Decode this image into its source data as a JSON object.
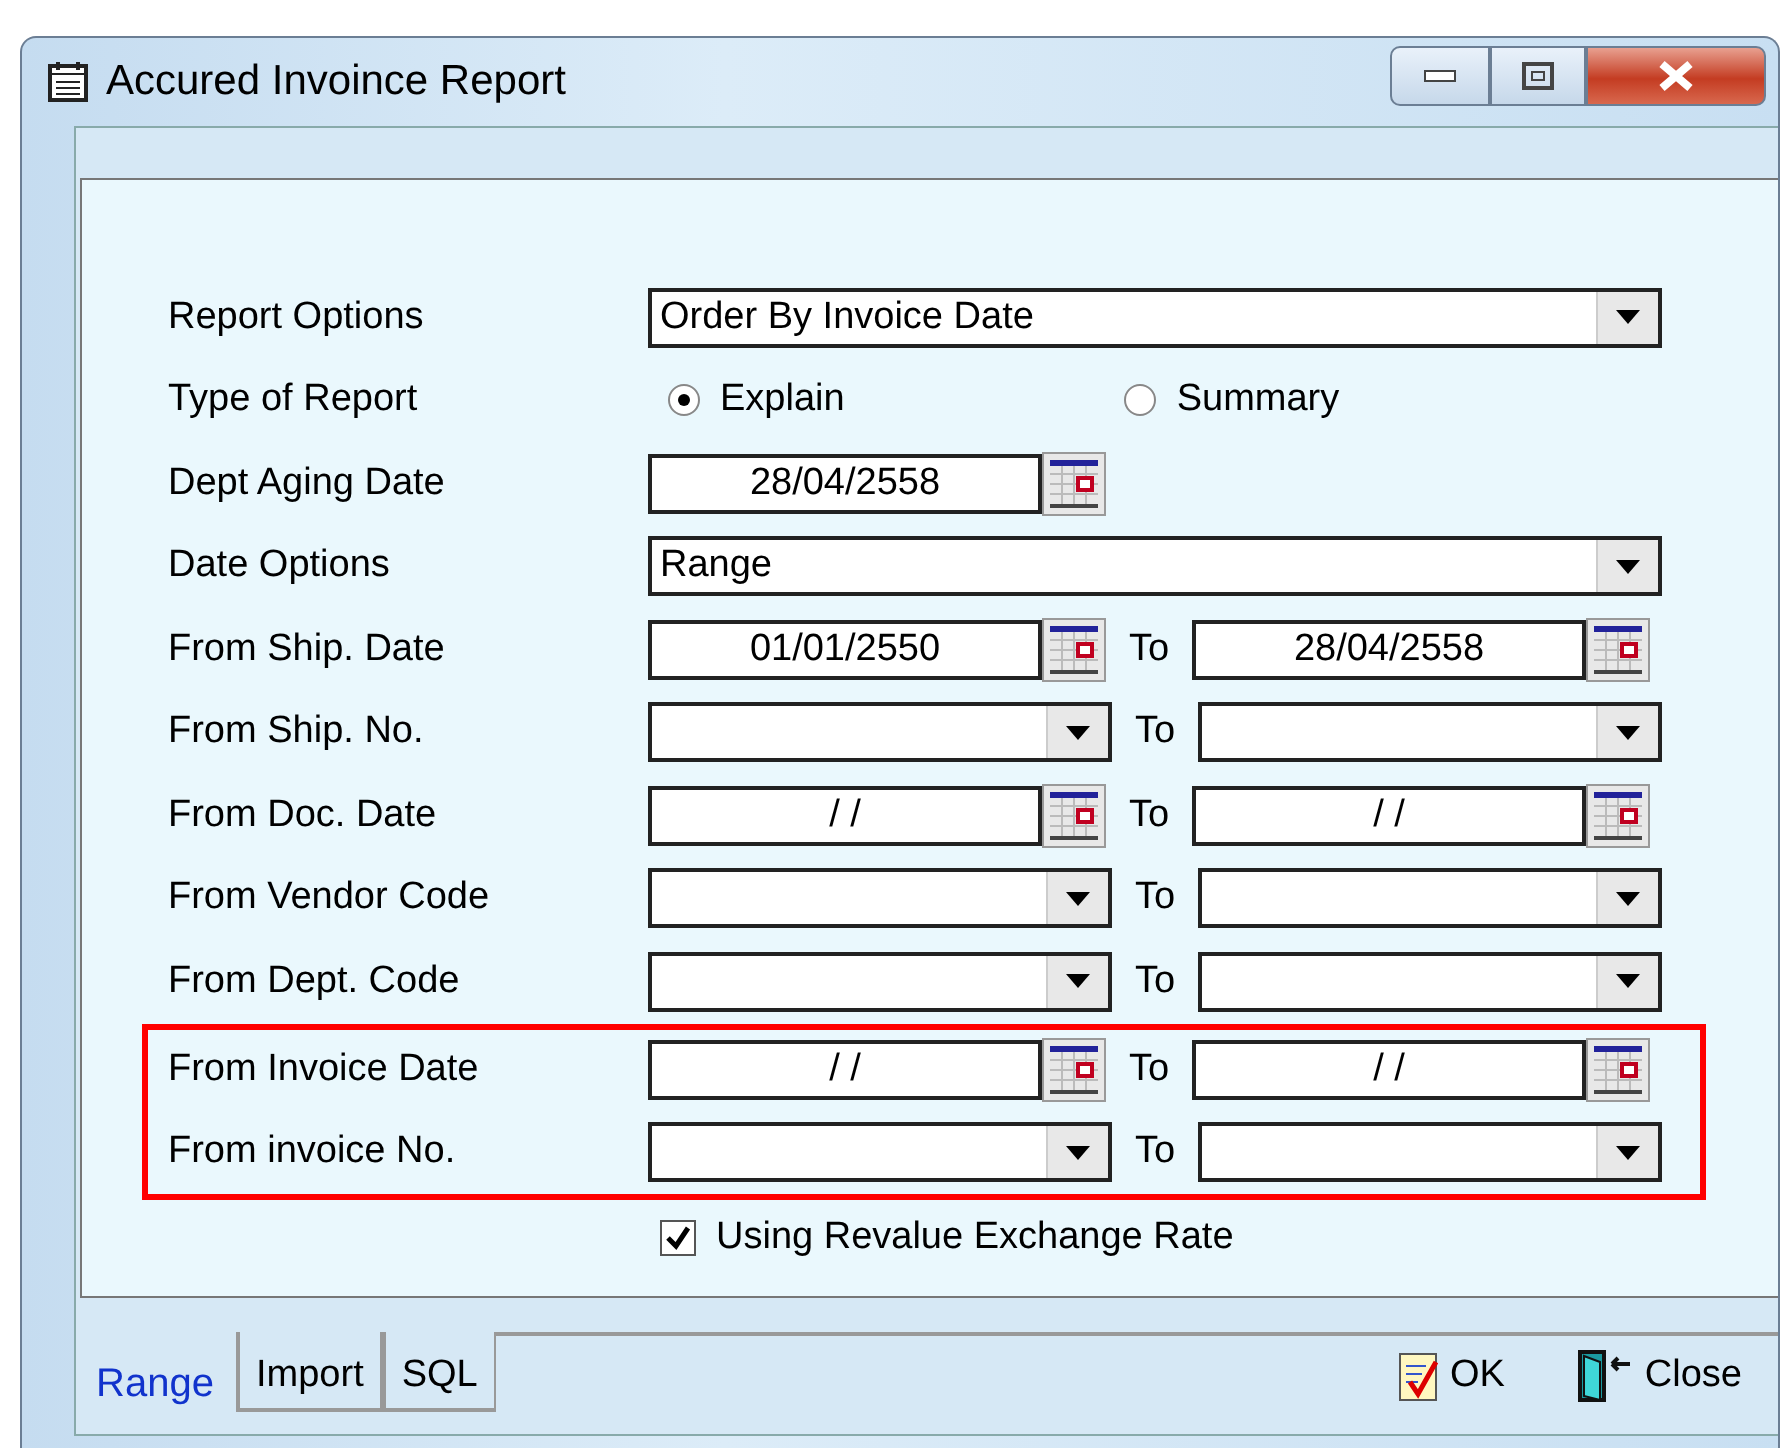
{
  "window": {
    "title": "Accured Invoince Report"
  },
  "rows": [
    {
      "kind": "combo",
      "label": "Report Options",
      "value": "Order By Invoice Date",
      "highlighted": false
    },
    {
      "kind": "radio",
      "label": "Type of Report",
      "options": [
        {
          "label": "Explain",
          "selected": true
        },
        {
          "label": "Summary",
          "selected": false
        }
      ],
      "highlighted": false
    },
    {
      "kind": "date",
      "label": "Dept Aging Date",
      "value": "28/04/2558",
      "highlighted": false
    },
    {
      "kind": "combo",
      "label": "Date Options",
      "value": "Range",
      "highlighted": false
    },
    {
      "kind": "date-range",
      "label": "From Ship. Date",
      "from": "01/01/2550",
      "to_label": "To",
      "to": "28/04/2558",
      "highlighted": false
    },
    {
      "kind": "combo-range",
      "label": "From Ship. No.",
      "to_label": "To",
      "highlighted": false
    },
    {
      "kind": "date-range",
      "label": "From Doc. Date",
      "from": "/ /",
      "to_label": "To",
      "to": "/ /",
      "highlighted": false
    },
    {
      "kind": "combo-range",
      "label": "From Vendor Code",
      "to_label": "To",
      "highlighted": false
    },
    {
      "kind": "combo-range",
      "label": "From Dept. Code",
      "to_label": "To",
      "highlighted": false
    },
    {
      "kind": "date-range",
      "label": "From Invoice Date",
      "from": "/ /",
      "to_label": "To",
      "to": "/ /",
      "highlighted": true
    },
    {
      "kind": "combo-range",
      "label": "From invoice No.",
      "to_label": "To",
      "highlighted": true
    }
  ],
  "checkbox": {
    "label": "Using Revalue Exchange Rate",
    "checked": true
  },
  "tabs": [
    {
      "label": "Range",
      "selected": true
    },
    {
      "label": "Import",
      "selected": false
    },
    {
      "label": "SQL",
      "selected": false
    }
  ],
  "buttons": [
    {
      "kind": "ok",
      "label": "OK"
    },
    {
      "kind": "close",
      "label": "Close"
    }
  ]
}
